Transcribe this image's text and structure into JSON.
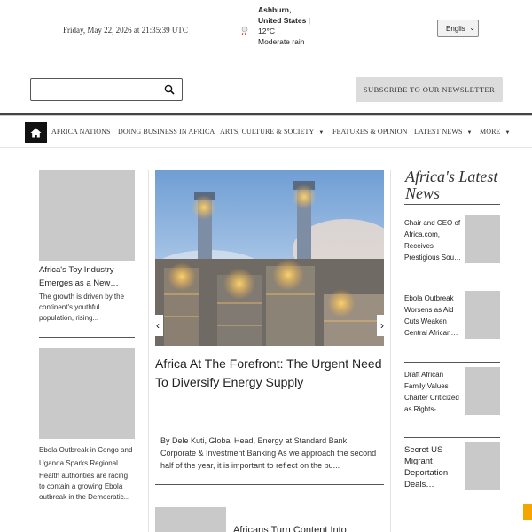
{
  "header": {
    "date": "Friday, May 22, 2026 at 21:35:39 UTC",
    "weather": {
      "location": "Ashburn, United States",
      "details": " | 12°C | Moderate rain",
      "icon": "rain-cloud-icon"
    },
    "language": "Englis"
  },
  "search": {
    "placeholder": "",
    "icon": "search-icon"
  },
  "newsletter": {
    "label": "SUBSCRIBE TO OUR NEWSLETTER"
  },
  "nav": {
    "items": [
      {
        "label": "AFRICA NATIONS",
        "dropdown": ""
      },
      {
        "label": "DOING BUSINESS IN AFRICA",
        "dropdown": ""
      },
      {
        "label": "ARTS, CULTURE & SOCIETY",
        "dropdown": "▼"
      },
      {
        "label": "FEATURES & OPINION",
        "dropdown": ""
      },
      {
        "label": "LATEST NEWS",
        "dropdown": "▼"
      },
      {
        "label": "MORE",
        "dropdown": "▼"
      }
    ]
  },
  "left_articles": [
    {
      "title": "Africa's Toy Industry Emerges as a New…",
      "excerpt": "The growth is driven by the continent's youthful population, rising..."
    },
    {
      "title": "Ebola Outbreak in Congo and Uganda Sparks Regional…",
      "excerpt": "Health authorities are racing to contain a growing Ebola outbreak in the Democratic..."
    }
  ],
  "featured": {
    "headline": "Africa At The Forefront: The Urgent Need To Diversify Energy Supply",
    "byline": "By Dele Kuti, Global Head, Energy at Standard Bank Corporate & Investment Banking As we approach the second half of the year, it is important to reflect on the bu...",
    "next_headline": "Africans Turn Content Into"
  },
  "latest": {
    "title": "Africa's Latest News",
    "items": [
      {
        "title": "Chair and CEO of Africa.com, Receives Prestigious Sou…"
      },
      {
        "title": "Ebola Outbreak Worsens as Aid Cuts Weaken Central African…"
      },
      {
        "title": "Draft African Family Values Charter Criticized as Rights-…"
      },
      {
        "title": "Secret US Migrant Deportation Deals…"
      }
    ]
  },
  "colors": {
    "accent": "#f5a400",
    "nav_home_bg": "#111111",
    "placeholder_gray": "#c9c9c9"
  }
}
